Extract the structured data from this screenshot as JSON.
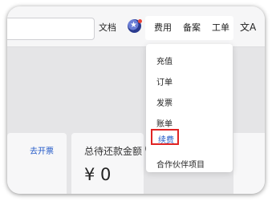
{
  "header": {
    "links": [
      "文档",
      "费用",
      "备案",
      "工单"
    ],
    "lang_icon": "文A"
  },
  "dropdown": {
    "items": [
      "充值",
      "订单",
      "发票",
      "账单",
      "续费",
      "合作伙伴项目"
    ],
    "highlighted": "续费"
  },
  "summary": {
    "invoice_link": "去开票",
    "total_label": "总待还款金额",
    "help_icon": "?",
    "amount": "¥ 0"
  },
  "colors": {
    "accent": "#2158c7",
    "highlight_border": "#e02424"
  },
  "icons": [
    "avatar",
    "translate-icon",
    "help-icon"
  ]
}
